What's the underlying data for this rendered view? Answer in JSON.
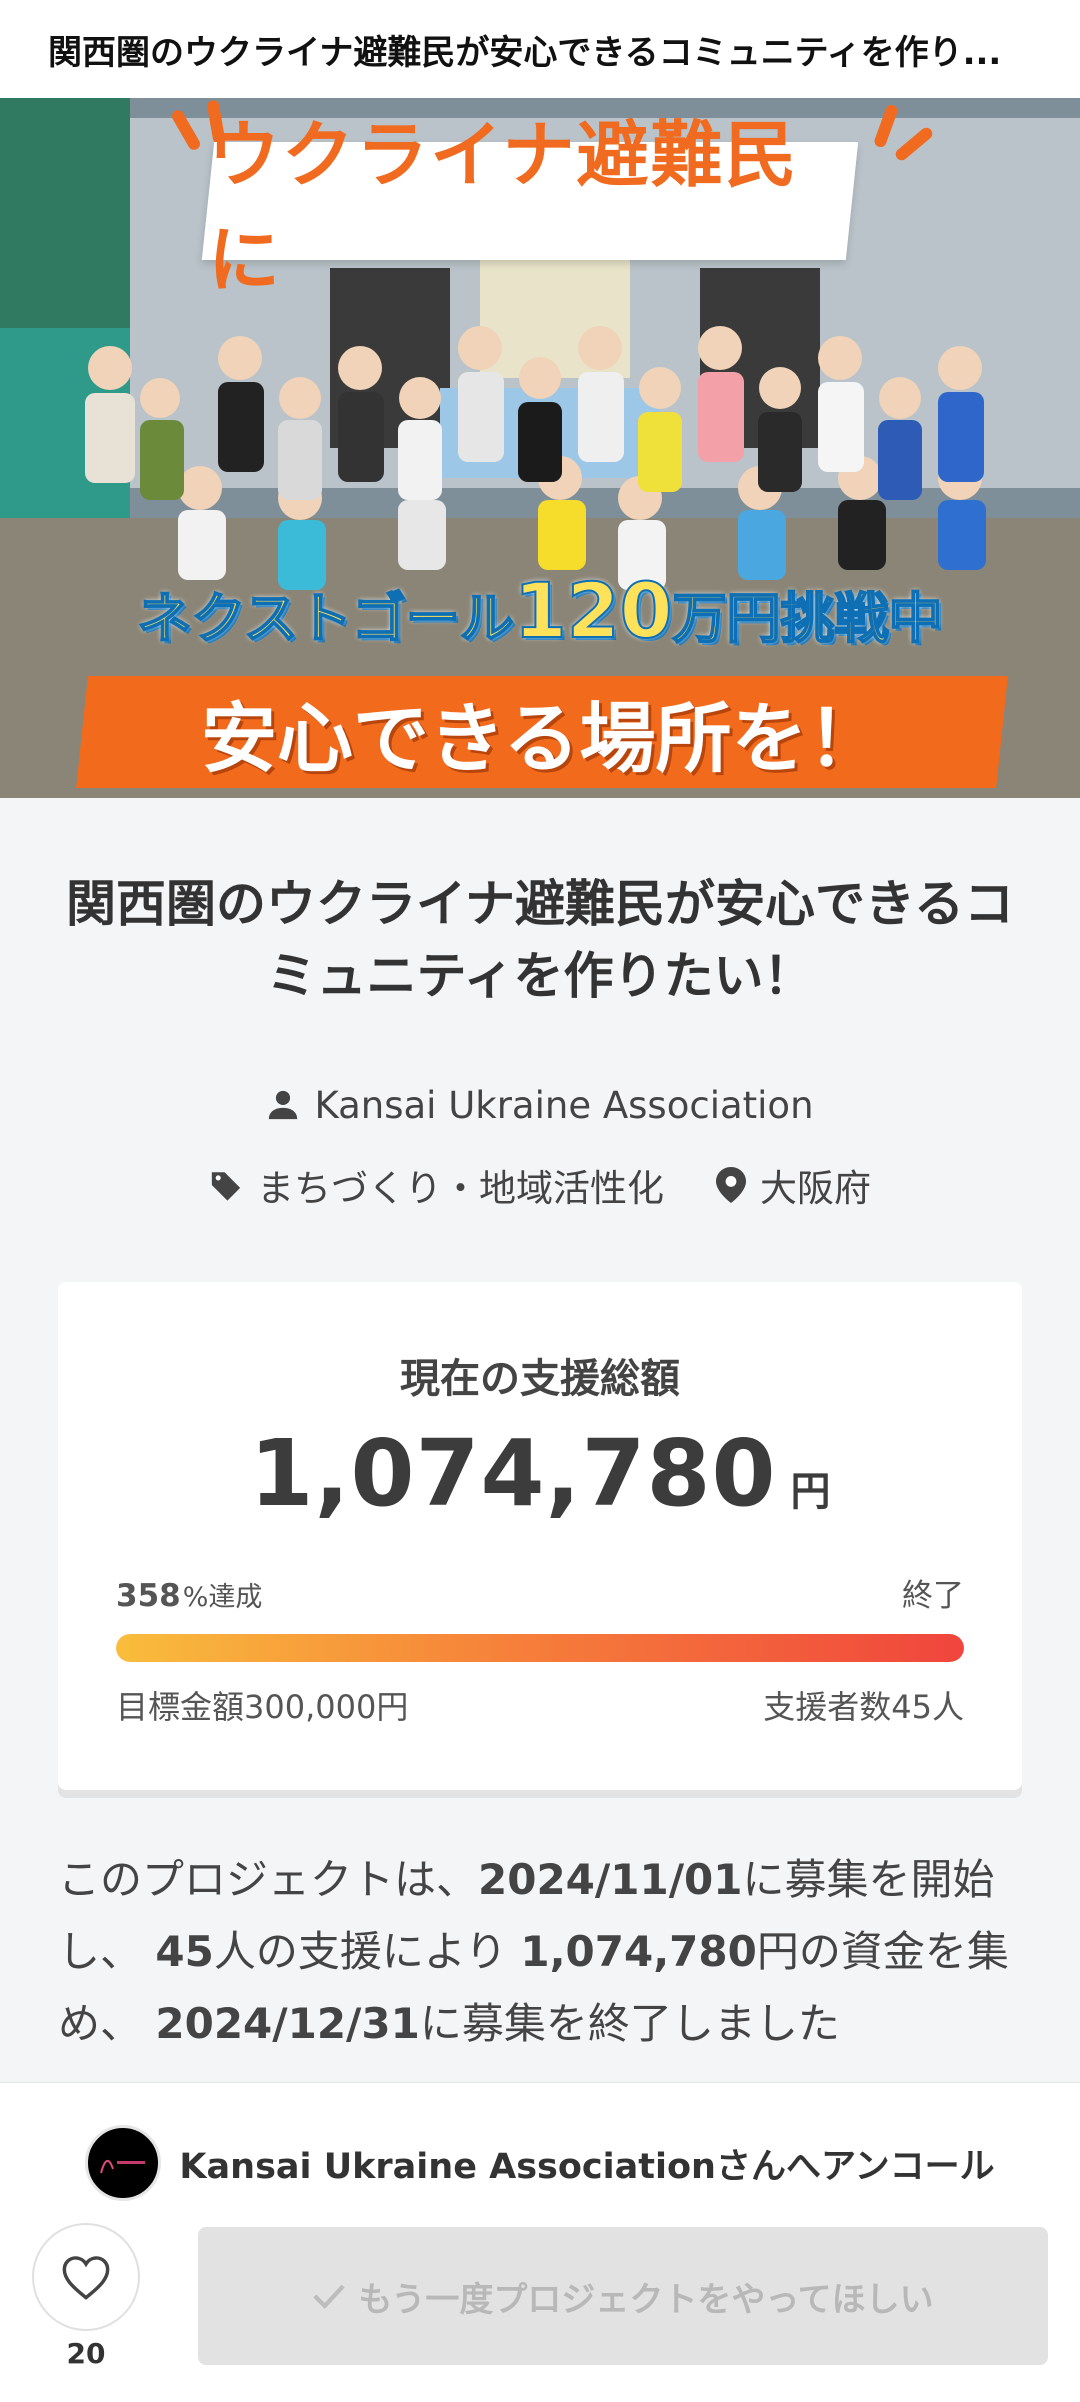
{
  "header": {
    "title": "関西圏のウクライナ避難民が安心できるコミュニティを作り..."
  },
  "hero": {
    "banner_top": "ウクライナ避難民に",
    "goal_prefix": "ネクストゴール",
    "goal_amount": "120",
    "goal_suffix": "万円挑戦中",
    "banner_bottom": "安心できる場所を！"
  },
  "project": {
    "title": "関西圏のウクライナ避難民が安心できるコミュニティを作りたい！",
    "owner": "Kansai Ukraine Association",
    "category": "まちづくり・地域活性化",
    "location": "大阪府"
  },
  "funding": {
    "label": "現在の支援総額",
    "amount": "1,074,780",
    "unit": "円",
    "percent_value": "358",
    "percent_suffix": "%達成",
    "progress_fraction": 1.0,
    "status": "終了",
    "target": "目標金額300,000円",
    "supporters": "支援者数45人"
  },
  "summary": {
    "t1": "このプロジェクトは、",
    "start_date": "2024/11/01",
    "t2": "に募集を開始し、",
    "backers": "45",
    "t3": "人の支援により",
    "amount": "1,074,780",
    "t4": "円の資金を集め、",
    "end_date": "2024/12/31",
    "t5": "に募集を終了しました"
  },
  "actions": {
    "encore_text": "Kansai Ukraine Associationさんへアンコール",
    "like_count": "20",
    "request_button": "もう一度プロジェクトをやってほしい"
  },
  "icons": {
    "owner": "person-icon",
    "category": "tag-icon",
    "location": "location-pin-icon",
    "like": "heart-outline-icon",
    "request": "check-icon"
  },
  "colors": {
    "accent_orange": "#f26b1d",
    "progress_start": "#f9bd3c",
    "progress_end": "#f0453d",
    "background": "#f4f5f7"
  }
}
